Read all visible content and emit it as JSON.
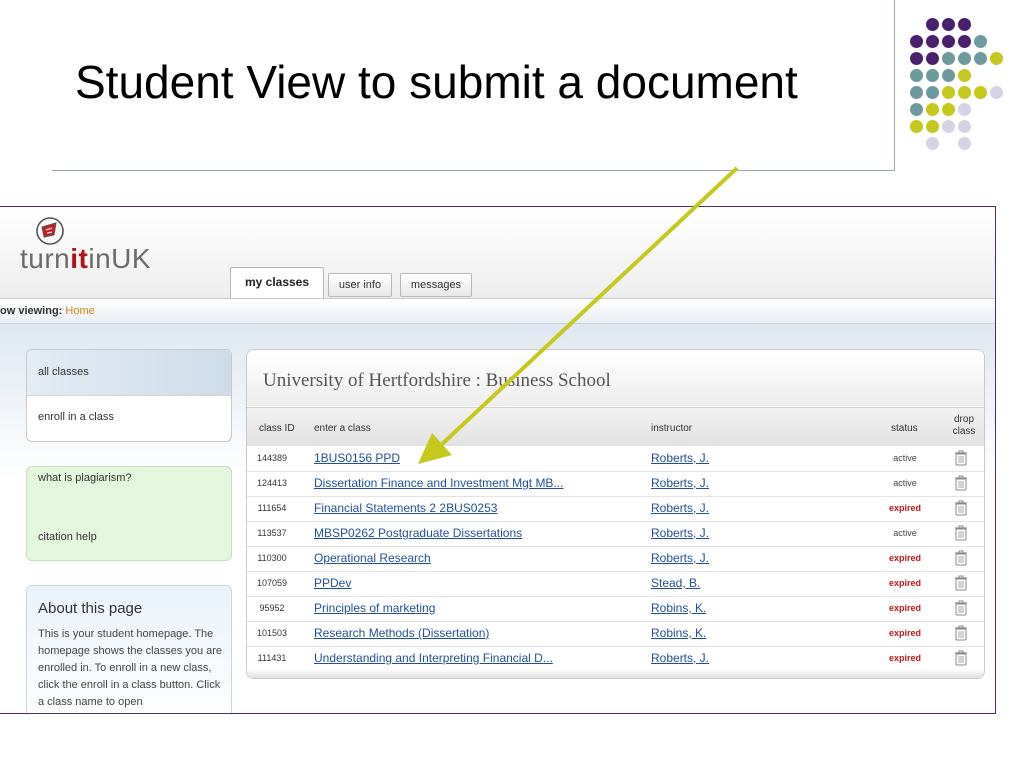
{
  "slide": {
    "title": "Student View to submit a document",
    "accent_colors": {
      "purple": "#4b1f6f",
      "teal": "#6c9a9e",
      "yellow": "#c6c81e",
      "lavender": "#d4d4e6"
    },
    "arrow_color": "#c6c81e"
  },
  "app": {
    "logo_prefix": "turn",
    "logo_it": "it",
    "logo_suffix": "inUK",
    "logo_icon": "turnitin-logo-icon"
  },
  "tabs": [
    {
      "label": "my classes",
      "active": true
    },
    {
      "label": "user info",
      "active": false
    },
    {
      "label": "messages",
      "active": false
    }
  ],
  "breadcrumb": {
    "label": "ow viewing:",
    "current": "Home"
  },
  "sidebar": {
    "group1": [
      "all classes",
      "enroll in a class"
    ],
    "group2": [
      "what is plagiarism?",
      "citation help"
    ],
    "about": {
      "title": "About this page",
      "text": "This is your student homepage. The homepage shows the classes you are enrolled in. To enroll in a new class, click the enroll in a class button. Click a class name to open"
    }
  },
  "panel": {
    "title": "University of Hertfordshire : Business School",
    "columns": {
      "class_id": "class ID",
      "class": "enter a class",
      "instructor": "instructor",
      "status": "status",
      "drop": "drop class"
    },
    "rows": [
      {
        "id": "144389",
        "name": "1BUS0156 PPD",
        "instructor": "Roberts, J.",
        "status": "active"
      },
      {
        "id": "124413",
        "name": "Dissertation Finance and Investment Mgt MB...",
        "instructor": "Roberts, J.",
        "status": "active"
      },
      {
        "id": "111654",
        "name": "Financial Statements 2 2BUS0253",
        "instructor": "Roberts, J.",
        "status": "expired"
      },
      {
        "id": "113537",
        "name": "MBSP0262 Postgraduate Dissertations",
        "instructor": "Roberts, J.",
        "status": "active"
      },
      {
        "id": "110300",
        "name": "Operational Research",
        "instructor": "Roberts, J.",
        "status": "expired"
      },
      {
        "id": "107059",
        "name": "PPDev",
        "instructor": "Stead, B.",
        "status": "expired"
      },
      {
        "id": "95952",
        "name": "Principles of marketing",
        "instructor": "Robins, K.",
        "status": "expired"
      },
      {
        "id": "101503",
        "name": "Research Methods (Dissertation)",
        "instructor": "Robins, K.",
        "status": "expired"
      },
      {
        "id": "111431",
        "name": "Understanding and Interpreting Financial D...",
        "instructor": "Roberts, J.",
        "status": "expired"
      }
    ],
    "trash_icon": "trash-icon"
  }
}
